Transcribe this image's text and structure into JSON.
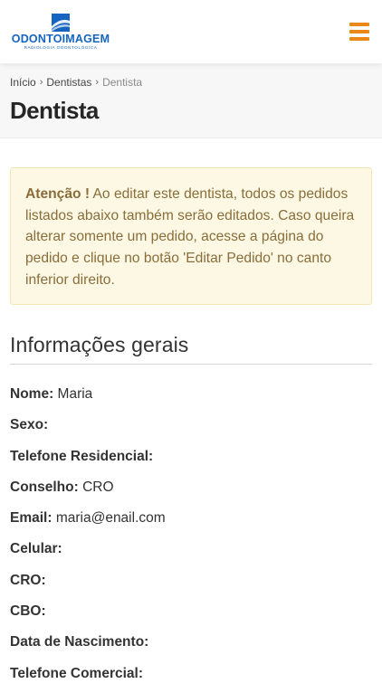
{
  "header": {
    "logo_text": "ODONTOIMAGEM",
    "logo_subtext": "RADIOLOGIA ODONTOLÓGICA",
    "brand_color": "#1565c0",
    "menu_icon": "hamburger-icon",
    "menu_color": "#e8891a"
  },
  "breadcrumb": {
    "items": [
      "Início",
      "Dentistas"
    ],
    "current": "Dentista",
    "separator_icon": "chevron-right-icon"
  },
  "page": {
    "title": "Dentista"
  },
  "alert": {
    "strong": "Atenção !",
    "text": " Ao editar este dentista, todos os pedidos listados abaixo também serão editados. Caso queira alterar somente um pedido, acesse a página do pedido e clique no botão 'Editar Pedido' no canto inferior direito."
  },
  "section": {
    "title": "Informações gerais"
  },
  "fields": [
    {
      "label": "Nome:",
      "value": "Maria"
    },
    {
      "label": "Sexo:",
      "value": ""
    },
    {
      "label": "Telefone Residencial:",
      "value": ""
    },
    {
      "label": "Conselho:",
      "value": "CRO"
    },
    {
      "label": "Email:",
      "value": "maria@enail.com"
    },
    {
      "label": "Celular:",
      "value": ""
    },
    {
      "label": "CRO:",
      "value": ""
    },
    {
      "label": "CBO:",
      "value": ""
    },
    {
      "label": "Data de Nascimento:",
      "value": ""
    },
    {
      "label": "Telefone Comercial:",
      "value": ""
    }
  ]
}
